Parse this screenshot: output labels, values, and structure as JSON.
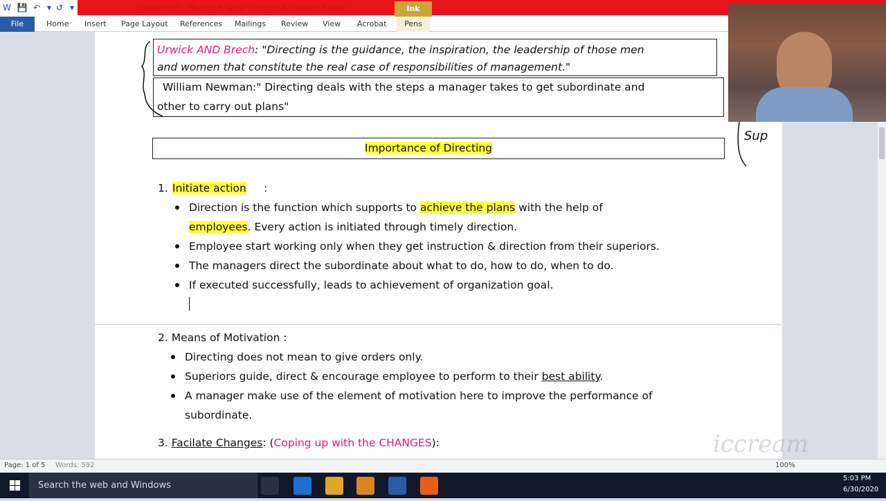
{
  "titlebar": {
    "title": "Document1 - Microsoft Word (Product Activation Failed)",
    "ink_tools": "Ink Tools"
  },
  "ribbon": {
    "tabs": [
      "File",
      "Home",
      "Insert",
      "Page Layout",
      "References",
      "Mailings",
      "Review",
      "View",
      "Acrobat",
      "Pens"
    ]
  },
  "doc": {
    "def1_author": "Urwick AND Brech",
    "def1_line1": ": \"Directing is the guidance, the inspiration, the leadership of those men",
    "def1_line2": "and women that constitute the real case of responsibilities of management.\"",
    "def2_author": "William Newman",
    "def2_line1": ":\" Directing deals with the steps a manager takes to get subordinate and",
    "def2_line2": "other to carry out plans\"",
    "heading": "Importance of Directing",
    "s1_num": "1.",
    "s1_title": "Initiate action",
    "s1_colon": ":",
    "s1_b1a": "Direction is the ",
    "s1_b1b": "function which supports to ",
    "s1_b1_hl": "achieve the plans",
    "s1_b1c": " with the help of",
    "s1_b1_hl2": "employees",
    "s1_b1d": ". Every action is initiated through timely direction.",
    "s1_b2": "Employee start working only when they get instruction & direction from their superiors.",
    "s1_b3": "The managers direct the subordinate about what to do, how to do, when to do.",
    "s1_b4": "If executed successfully, leads to achievement of organization goal.",
    "s2_title": "2. Means of Motivation :",
    "s2_b1": "Directing does not mean to give orders only.",
    "s2_b2a": "Superiors guide, direct & encourage employee to perform to their ",
    "s2_b2b": "best ability",
    "s2_b2c": ".",
    "s2_b3": "A manager make use of the element of motivation here  to improve the performance of",
    "s2_b3_cont": "subordinate.",
    "s3_a": "3. ",
    "s3_b": "Facilate Changes",
    "s3_c": ": (",
    "s3_d": "Coping up with the CHANGES",
    "s3_e": "):",
    "ink_note": "Sup"
  },
  "statusbar": {
    "page": "Page: 1 of 5",
    "words": "Words: 592",
    "zoom": "100%"
  },
  "taskbar": {
    "search_placeholder": "Search the web and Windows",
    "time": "5:03 PM",
    "date": "6/30/2020"
  },
  "watermark": "iccream"
}
